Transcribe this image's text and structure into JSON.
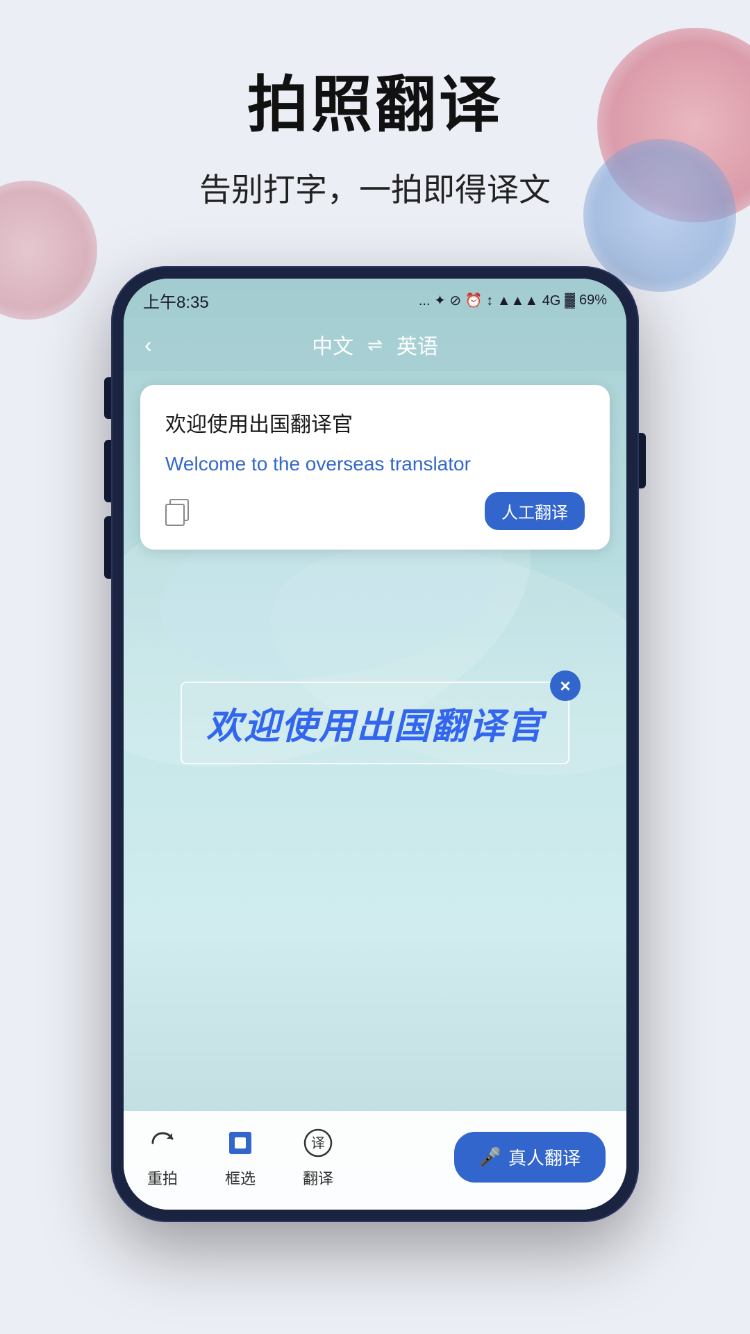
{
  "page": {
    "main_title": "拍照翻译",
    "sub_title": "告别打字，一拍即得译文"
  },
  "status_bar": {
    "time": "上午8:35",
    "icons": "... ✦ ⊘ ⏰ ↑↓ .ull 4G",
    "battery": "69%"
  },
  "nav": {
    "back_icon": "‹",
    "source_lang": "中文",
    "swap_icon": "⇌",
    "target_lang": "英语"
  },
  "translation_card": {
    "source_text": "欢迎使用出国翻译官",
    "result_text": "Welcome to the overseas translator",
    "copy_label": "copy",
    "human_translate_label": "人工翻译"
  },
  "ocr": {
    "text": "欢迎使用出国翻译官",
    "close_icon": "×"
  },
  "toolbar": {
    "retake_label": "重拍",
    "retake_icon": "↩",
    "select_label": "框选",
    "translate_label": "翻译",
    "real_translate_label": "真人翻译",
    "real_translate_icon": "🎤"
  }
}
